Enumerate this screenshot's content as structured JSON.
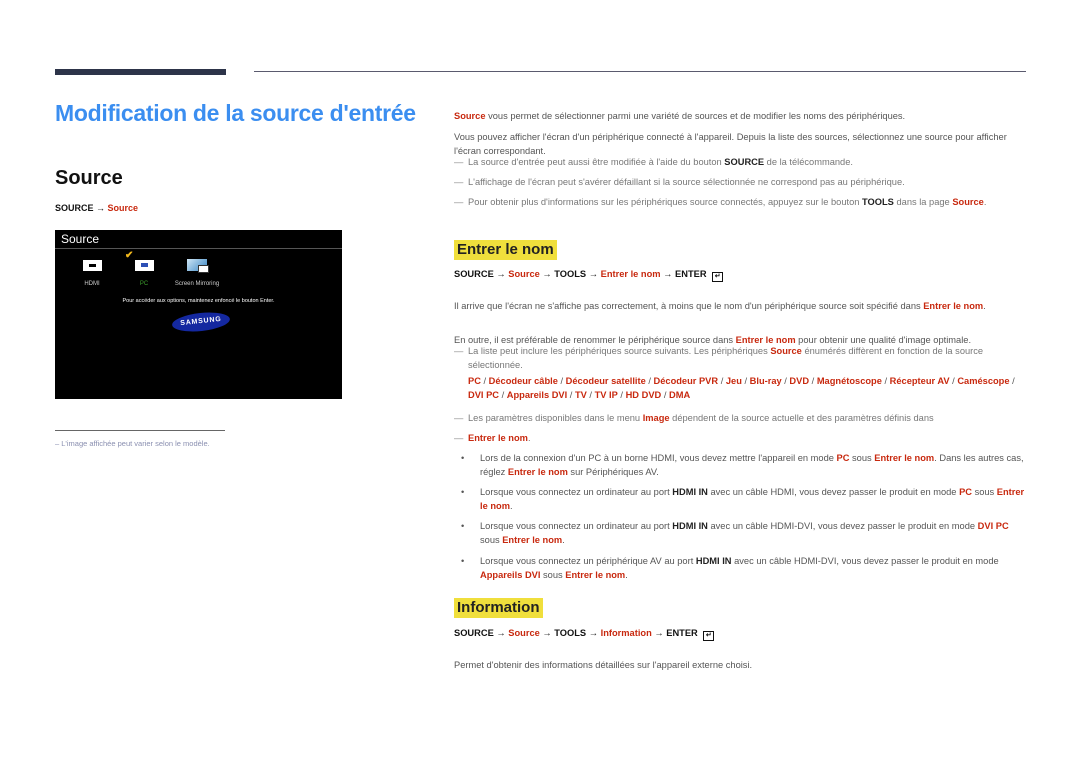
{
  "page": {
    "title": "Modification de la source d'entrée"
  },
  "left": {
    "section_title": "Source",
    "path": {
      "prefix": "SOURCE",
      "arrow": "→",
      "item": "Source"
    },
    "tv_screen": {
      "header": "Source",
      "items": [
        {
          "label": "HDMI",
          "icon": "hdmi-icon",
          "selected": false
        },
        {
          "label": "PC",
          "icon": "pc-icon",
          "selected": true
        },
        {
          "label": "Screen Mirroring",
          "icon": "screen-mirroring-icon",
          "selected": false
        }
      ],
      "selected_marker": "✔",
      "message": "Pour accéder aux options, maintenez enfoncé le bouton Enter.",
      "logo": "SAMSUNG"
    },
    "footnote": {
      "dash": "–",
      "text": "L'image affichée peut varier selon le modèle."
    }
  },
  "right": {
    "intro": {
      "lead_red": "Source",
      "lead_rest": " vous permet de sélectionner parmi une variété de sources et de modifier les noms des périphériques.",
      "para2": "Vous pouvez afficher l'écran d'un périphérique connecté à l'appareil. Depuis la liste des sources, sélectionnez une source pour afficher l'écran correspondant."
    },
    "notes": [
      {
        "pre": "La source d'entrée peut aussi être modifiée à l'aide du bouton ",
        "bold": "SOURCE",
        "post": " de la télécommande."
      },
      {
        "text": "L'affichage de l'écran peut s'avérer défaillant si la source sélectionnée ne correspond pas au périphérique."
      },
      {
        "pre": "Pour obtenir plus d'informations sur les périphériques source connectés, appuyez sur le bouton ",
        "bold": "TOOLS",
        "post": " dans la page ",
        "red": "Source",
        "end": "."
      }
    ],
    "entrer_le_nom": {
      "title": "Entrer le nom",
      "path": {
        "p1": "SOURCE",
        "p2": "Source",
        "p3": "TOOLS",
        "p4": "Entrer le nom",
        "p5": "ENTER",
        "arrow": "→",
        "enter_icon": "↵"
      },
      "para1_pre": "Il arrive que l'écran ne s'affiche pas correctement, à moins que le nom d'un périphérique source soit spécifié dans ",
      "para1_red": "Entrer le nom",
      "para1_end": ".",
      "para2_pre": "En outre, il est préférable de renommer le périphérique source dans ",
      "para2_red": "Entrer le nom",
      "para2_post": " pour obtenir une qualité d'image optimale.",
      "note1_pre": "La liste peut inclure les périphériques source suivants. Les périphériques ",
      "note1_red": "Source",
      "note1_post": " énumérés diffèrent en fonction de la source sélectionnée.",
      "devices": [
        "PC",
        "Décodeur câble",
        "Décodeur satellite",
        "Décodeur PVR",
        "Jeu",
        "Blu-ray",
        "DVD",
        "Magnétoscope",
        "Récepteur AV",
        "Caméscope",
        "DVI PC",
        "Appareils DVI",
        "TV",
        "TV IP",
        "HD DVD",
        "DMA"
      ],
      "separator": " / ",
      "note2_pre": "Les paramètres disponibles dans le menu ",
      "note2_red": "Image",
      "note2_post": " dépendent de la source actuelle et des paramètres définis dans",
      "note3_red": "Entrer le nom",
      "note3_end": ".",
      "bullets": [
        {
          "a": "Lors de la connexion d'un PC à un borne HDMI, vous devez mettre l'appareil en mode ",
          "r1": "PC",
          "b": " sous ",
          "r2": "Entrer le nom",
          "c": ". Dans les autres cas, réglez ",
          "r3": "Entrer le nom",
          "d": " sur Périphériques AV."
        },
        {
          "a": "Lorsque vous connectez un ordinateur au port ",
          "k": "HDMI IN",
          "b": " avec un câble HDMI, vous devez passer le produit en mode ",
          "r1": "PC",
          "c": " sous ",
          "r2": "Entrer le nom",
          "d": "."
        },
        {
          "a": "Lorsque vous connectez un ordinateur au port ",
          "k": "HDMI IN",
          "b": " avec un câble HDMI-DVI, vous devez passer le produit en mode ",
          "r1": "DVI PC",
          "c": " sous ",
          "r2": "Entrer le nom",
          "d": "."
        },
        {
          "a": "Lorsque vous connectez un périphérique AV au port ",
          "k": "HDMI IN",
          "b": " avec un câble HDMI-DVI, vous devez passer le produit en mode ",
          "r1": "Appareils DVI",
          "c": " sous ",
          "r2": "Entrer le nom",
          "d": "."
        }
      ],
      "bullet_glyph": "•"
    },
    "information": {
      "title": "Information",
      "path": {
        "p1": "SOURCE",
        "p2": "Source",
        "p3": "TOOLS",
        "p4": "Information",
        "p5": "ENTER",
        "arrow": "→",
        "enter_icon": "↵"
      },
      "text": "Permet d'obtenir des informations détaillées sur l'appareil externe choisi."
    }
  },
  "colors": {
    "title_blue": "#3b8ef0",
    "accent_red": "#c8290f",
    "highlight_yellow": "#f0df3c",
    "topbar_navy": "#2d3449",
    "samsung_blue": "#1428a0"
  }
}
